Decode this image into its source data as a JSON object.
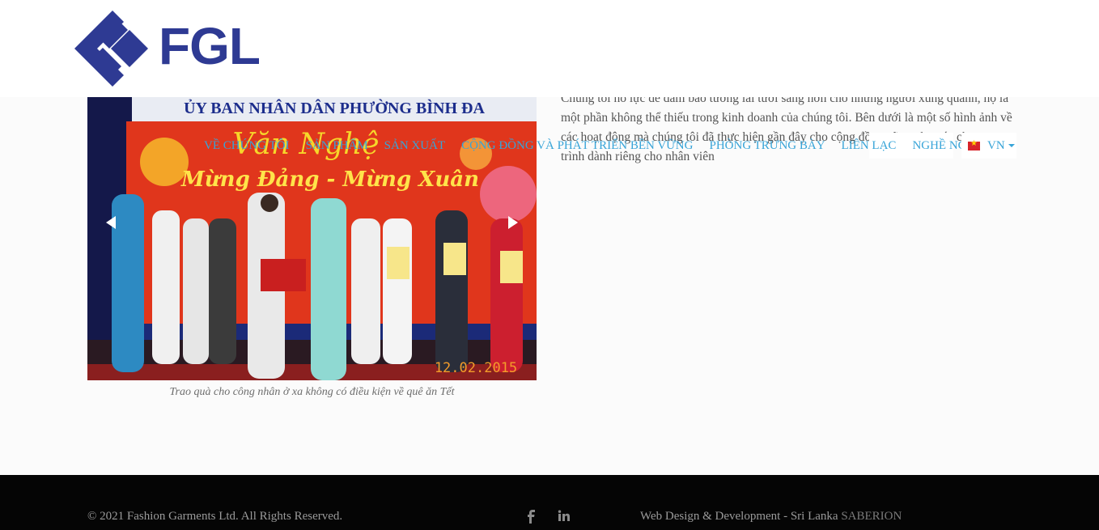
{
  "brand": {
    "name": "FGL",
    "logo_icon": "fgl-logo-icon",
    "color": "#2e3a93"
  },
  "nav": {
    "items": [
      {
        "label": "VỀ CHÚNG TÔI"
      },
      {
        "label": "SẢN PHẨM"
      },
      {
        "label": "SẢN XUẤT"
      },
      {
        "label": "CỘNG ĐỒNG VÀ PHÁT TRIỂN BỀN VỮNG"
      },
      {
        "label": "PHÒNG TRƯNG BÀY"
      },
      {
        "label": "LIÊN LẠC"
      },
      {
        "label": "NGHỀ NGHIỆP",
        "dropdown": true
      }
    ],
    "language": {
      "label": "VN",
      "flag_icon": "vietnam-flag-icon"
    },
    "link_color": "#37a4d8"
  },
  "slideshow": {
    "banner_top": "ỦY BAN NHÂN DÂN PHƯỜNG BÌNH ĐA",
    "banner_art": "Văn Nghệ",
    "banner_line": "Mừng Đảng - Mừng Xuân",
    "date_stamp": "12.02.2015",
    "caption": "Trao quà cho công nhân ở xa không có điều kiện về quê ăn Tết"
  },
  "content": {
    "paragraph": "Chúng tôi nỗ lực để đảm bảo tương lai tươi sáng hơn cho những người xung quanh, họ là một phần không thể thiếu trong kinh doanh của chúng tôi. Bên dưới là một số hình ảnh về các hoạt động mà chúng tôi đã thực hiện gần đây cho cộng đồng cũng như các chương trình dành riêng cho nhân viên"
  },
  "footer": {
    "copyright": "© 2021 Fashion Garments Ltd. All Rights Reserved.",
    "credit_text": "Web Design & Development - Sri Lanka ",
    "credit_link": "SABERION",
    "social": [
      "facebook-icon",
      "linkedin-icon"
    ]
  }
}
